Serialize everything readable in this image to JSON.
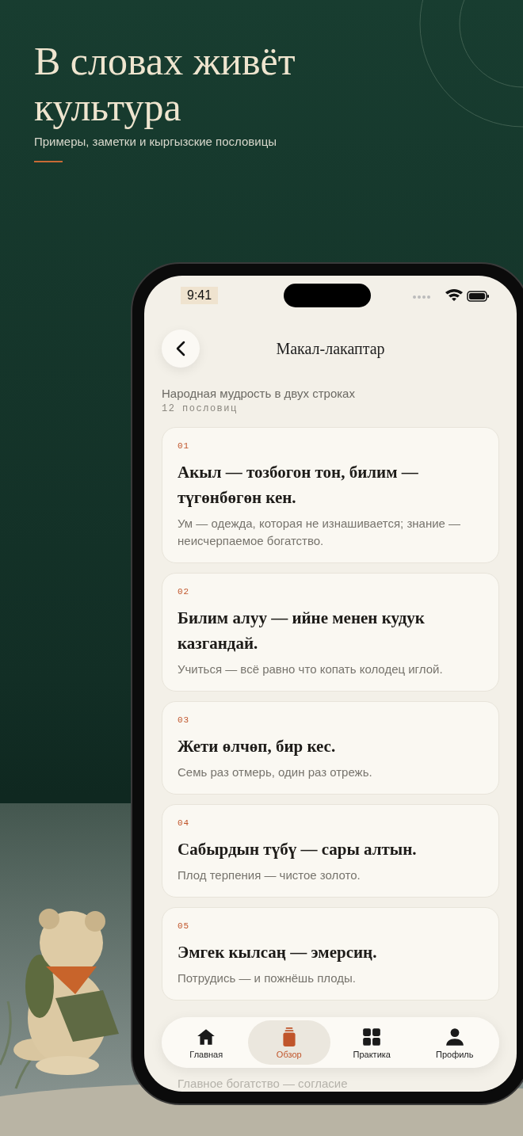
{
  "hero": {
    "title": "В словах живёт культура",
    "subtitle": "Примеры, заметки и кыргызские пословицы"
  },
  "status_bar": {
    "time": "9:41"
  },
  "header": {
    "title": "Макал-лакаптар"
  },
  "intro": {
    "subtitle": "Народная мудрость в двух строках",
    "count": "12 пословиц"
  },
  "proverbs": [
    {
      "number": "01",
      "text": "Акыл — тозбогон тон, билим — түгөнбөгөн кен.",
      "translation": "Ум — одежда, которая не изнашивается; знание — неисчерпаемое богатство."
    },
    {
      "number": "02",
      "text": "Билим алуу — ийне менен кудук казгандай.",
      "translation": "Учиться — всё равно что копать колодец иглой."
    },
    {
      "number": "03",
      "text": "Жети өлчөп, бир кес.",
      "translation": "Семь раз отмерь, один раз отрежь."
    },
    {
      "number": "04",
      "text": "Сабырдын түбү — сары алтын.",
      "translation": "Плод терпения — чистое золото."
    },
    {
      "number": "05",
      "text": "Эмгек кылсаң — эмерсиң.",
      "translation": "Потрудись — и пожнёшь плоды."
    },
    {
      "translation": "Главное богатство — согласие"
    }
  ],
  "nav": {
    "items": [
      {
        "label": "Главная",
        "kind": "home",
        "selected": false
      },
      {
        "label": "Обзор",
        "kind": "jar",
        "selected": true
      },
      {
        "label": "Практика",
        "kind": "grid",
        "selected": false
      },
      {
        "label": "Профиль",
        "kind": "person",
        "selected": false
      }
    ]
  }
}
